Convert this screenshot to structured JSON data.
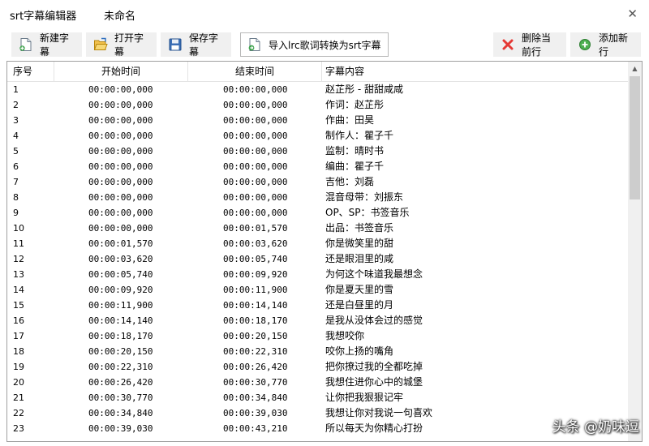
{
  "window": {
    "app_title": "srt字幕编辑器",
    "document_name": "未命名",
    "close_glyph": "✕"
  },
  "toolbar": {
    "new": "新建字幕",
    "open": "打开字幕",
    "save": "保存字幕",
    "import_lrc": "导入lrc歌词转换为srt字幕",
    "delete_row": "删除当前行",
    "add_row": "添加新行"
  },
  "table": {
    "columns": [
      "序号",
      "开始时间",
      "结束时间",
      "字幕内容"
    ],
    "rows": [
      [
        "1",
        "00:00:00,000",
        "00:00:00,000",
        "赵芷彤 - 甜甜咸咸"
      ],
      [
        "2",
        "00:00:00,000",
        "00:00:00,000",
        "作词：赵芷彤"
      ],
      [
        "3",
        "00:00:00,000",
        "00:00:00,000",
        "作曲：田昊"
      ],
      [
        "4",
        "00:00:00,000",
        "00:00:00,000",
        "制作人：瞿子千"
      ],
      [
        "5",
        "00:00:00,000",
        "00:00:00,000",
        "监制：晴时书"
      ],
      [
        "6",
        "00:00:00,000",
        "00:00:00,000",
        "编曲：瞿子千"
      ],
      [
        "7",
        "00:00:00,000",
        "00:00:00,000",
        "吉他：刘磊"
      ],
      [
        "8",
        "00:00:00,000",
        "00:00:00,000",
        "混音母带：刘振东"
      ],
      [
        "9",
        "00:00:00,000",
        "00:00:00,000",
        "OP、SP：书签音乐"
      ],
      [
        "10",
        "00:00:00,000",
        "00:00:01,570",
        "出品：书签音乐"
      ],
      [
        "11",
        "00:00:01,570",
        "00:00:03,620",
        "你是微笑里的甜"
      ],
      [
        "12",
        "00:00:03,620",
        "00:00:05,740",
        "还是眼泪里的咸"
      ],
      [
        "13",
        "00:00:05,740",
        "00:00:09,920",
        "为何这个味道我最想念"
      ],
      [
        "14",
        "00:00:09,920",
        "00:00:11,900",
        "你是夏天里的雪"
      ],
      [
        "15",
        "00:00:11,900",
        "00:00:14,140",
        "还是白昼里的月"
      ],
      [
        "16",
        "00:00:14,140",
        "00:00:18,170",
        "是我从没体会过的感觉"
      ],
      [
        "17",
        "00:00:18,170",
        "00:00:20,150",
        "我想咬你"
      ],
      [
        "18",
        "00:00:20,150",
        "00:00:22,310",
        "咬你上扬的嘴角"
      ],
      [
        "19",
        "00:00:22,310",
        "00:00:26,420",
        "把你撩过我的全都吃掉"
      ],
      [
        "20",
        "00:00:26,420",
        "00:00:30,770",
        "我想住进你心中的城堡"
      ],
      [
        "21",
        "00:00:30,770",
        "00:00:34,840",
        "让你把我狠狠记牢"
      ],
      [
        "22",
        "00:00:34,840",
        "00:00:39,030",
        "我想让你对我说一句喜欢"
      ],
      [
        "23",
        "00:00:39,030",
        "00:00:43,210",
        "所以每天为你精心打扮"
      ]
    ]
  },
  "watermark": "头条 @奶味逗",
  "colors": {
    "grid_border": "#a0a0a0",
    "active_button_border": "#b8b8b8",
    "delete_icon": "#e53935",
    "add_icon": "#4caf50"
  },
  "icons": {
    "new": "new-document-icon",
    "open": "open-folder-icon",
    "save": "floppy-disk-icon",
    "import": "import-document-icon",
    "delete": "red-x-icon",
    "add": "green-plus-icon"
  }
}
